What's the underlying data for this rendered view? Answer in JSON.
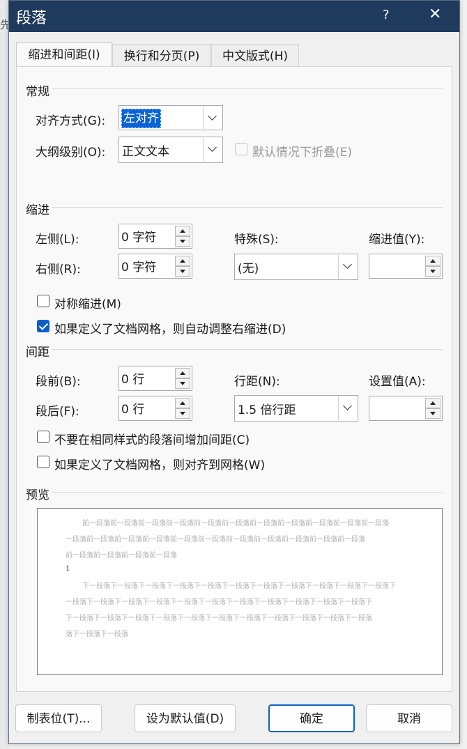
{
  "window": {
    "title": "段落",
    "help": "?",
    "close": "✕"
  },
  "tabs": [
    {
      "label": "缩进和间距(I)",
      "active": true
    },
    {
      "label": "换行和分页(P)",
      "active": false
    },
    {
      "label": "中文版式(H)",
      "active": false
    }
  ],
  "general": {
    "section": "常规",
    "alignment_label": "对齐方式(G):",
    "alignment_value": "左对齐",
    "outline_label": "大纲级别(O):",
    "outline_value": "正文文本",
    "collapse_label": "默认情况下折叠(E)"
  },
  "indent": {
    "section": "缩进",
    "left_label": "左侧(L):",
    "left_value": "0 字符",
    "right_label": "右侧(R):",
    "right_value": "0 字符",
    "special_label": "特殊(S):",
    "special_value": "(无)",
    "by_label": "缩进值(Y):",
    "by_value": "",
    "mirror_label": "对称缩进(M)",
    "mirror_checked": false,
    "auto_adjust_label": "如果定义了文档网格，则自动调整右缩进(D)",
    "auto_adjust_checked": true
  },
  "spacing": {
    "section": "间距",
    "before_label": "段前(B):",
    "before_value": "0 行",
    "after_label": "段后(F):",
    "after_value": "0 行",
    "line_label": "行距(N):",
    "line_value": "1.5 倍行距",
    "at_label": "设置值(A):",
    "at_value": "",
    "no_space_label": "不要在相同样式的段落间增加间距(C)",
    "no_space_checked": false,
    "snap_label": "如果定义了文档网格，则对齐到网格(W)",
    "snap_checked": false
  },
  "preview": {
    "section": "预览",
    "prev_lines": [
      "前一段落前一段落前一段落前一段落前一段落前一段落前一段落前一段落前一段落前一段落前一段落",
      "一段落前一段落前一段落前一段落前一段落前一段落前一段落前一段落前一段落前一段落前一段落",
      "前一段落前一段落前一段落前一段落"
    ],
    "current": "1",
    "next_lines": [
      "下一段落下一段落下一段落下一段落下一段落下一段落下一段落下一段落下一段落下一段落下一段落下",
      "一段落下一段落下一段落下一段落下一段落下一段落下一段落下一段落下一段落下一段落下一段落下",
      "下一段落下一段落下一段落下一段落下一段落下一段落下一段落下一段落下一段落下一段落下一段落",
      "落下一段落下一段落"
    ]
  },
  "buttons": {
    "tabs": "制表位(T)...",
    "default": "设为默认值(D)",
    "ok": "确定",
    "cancel": "取消"
  },
  "colors": {
    "titlebar": "#1e3a5c",
    "accent": "#0a5fc4"
  }
}
